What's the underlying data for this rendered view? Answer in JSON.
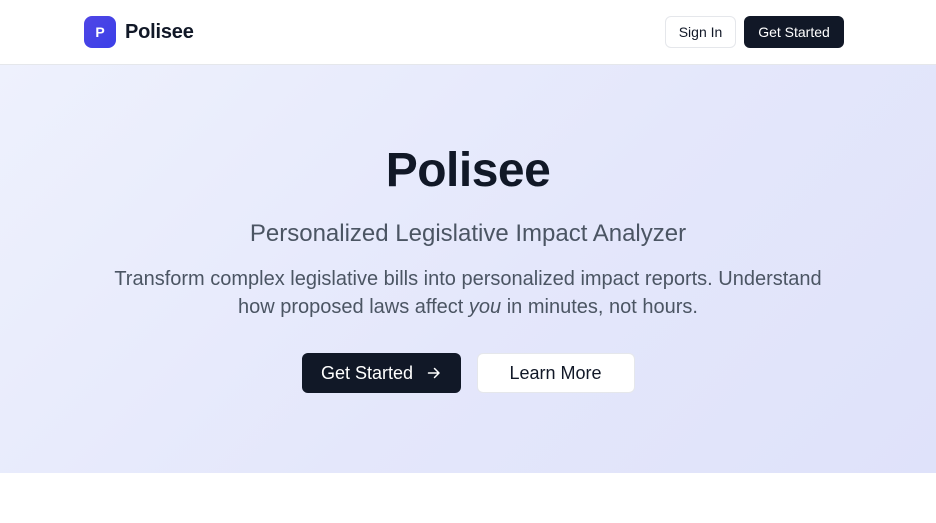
{
  "header": {
    "logo_letter": "P",
    "brand_name": "Polisee",
    "sign_in_label": "Sign In",
    "get_started_label": "Get Started"
  },
  "hero": {
    "title": "Polisee",
    "subtitle": "Personalized Legislative Impact Analyzer",
    "description_part1": "Transform complex legislative bills into personalized impact reports. Understand how proposed laws affect ",
    "description_emphasis": "you",
    "description_part2": " in minutes, not hours.",
    "primary_cta_label": "Get Started",
    "primary_cta_icon": "arrow-right-icon",
    "secondary_cta_label": "Learn More"
  },
  "colors": {
    "brand_accent": "#4f46e5",
    "dark_button": "#111827",
    "hero_background": "#e4e7fb"
  }
}
